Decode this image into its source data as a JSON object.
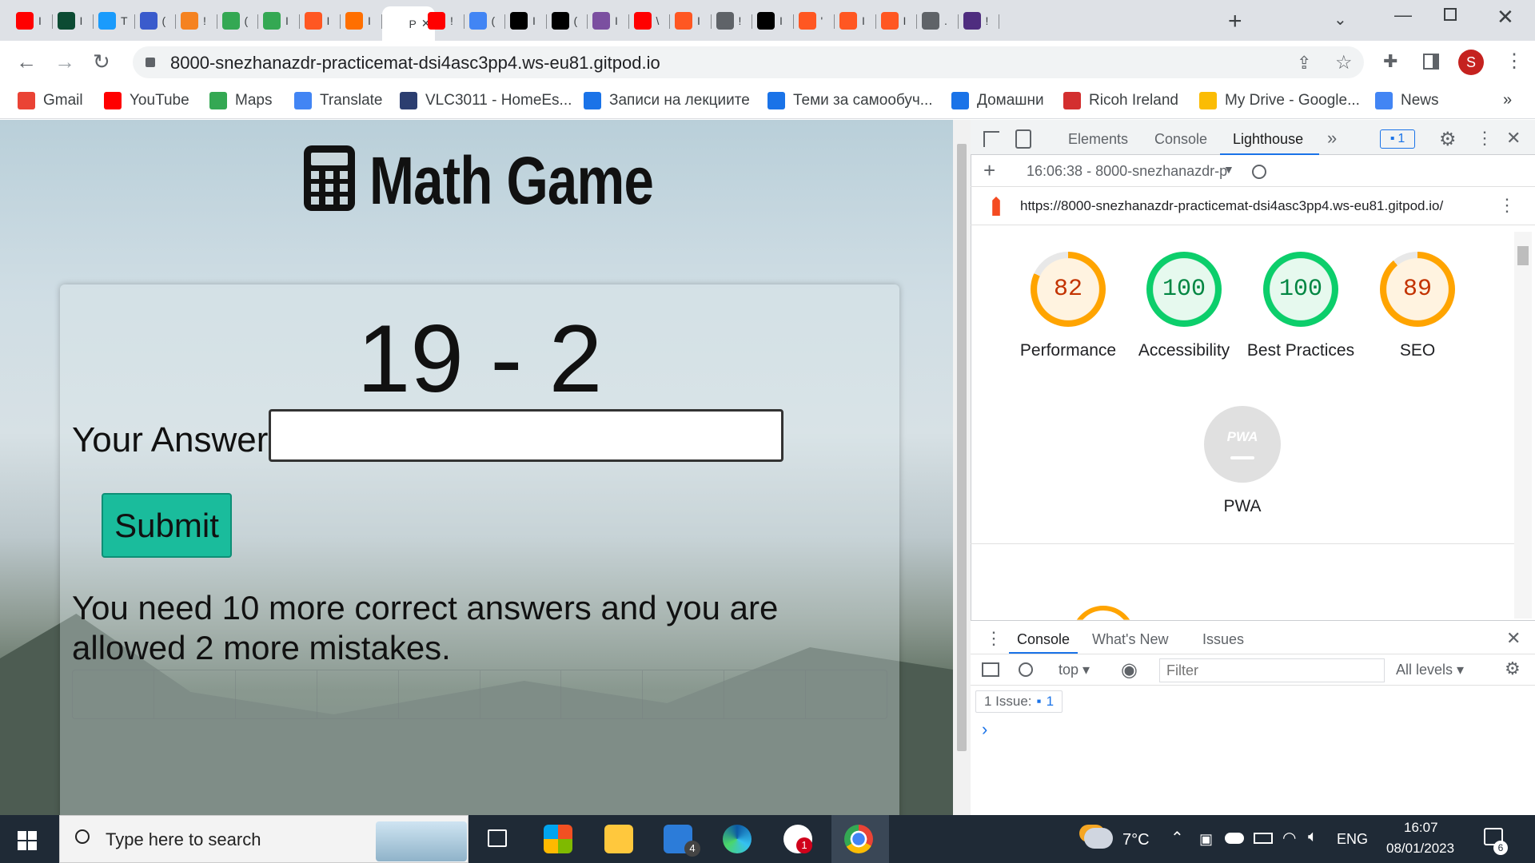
{
  "tabs": [
    {
      "label": "I",
      "color": "#ff0000",
      "icon": "youtube-icon"
    },
    {
      "label": "I",
      "color": "#0c4b33",
      "icon": "django-icon"
    },
    {
      "label": "T",
      "color": "#1a9bfc",
      "icon": "tab-icon"
    },
    {
      "label": "(",
      "color": "#3a5bcc",
      "icon": "tab-icon"
    },
    {
      "label": "!",
      "color": "#f58220",
      "icon": "tab-icon"
    },
    {
      "label": "(",
      "color": "#34a853",
      "icon": "maps-icon"
    },
    {
      "label": "I",
      "color": "#34a853",
      "icon": "maps-icon"
    },
    {
      "label": "I",
      "color": "#ff5722",
      "icon": "tab-icon"
    },
    {
      "label": "I",
      "color": "#ff6f00",
      "icon": "tab-icon"
    },
    {
      "label": "P",
      "color": "#ffffff",
      "icon": "tab-icon",
      "active": true
    },
    {
      "label": "!",
      "color": "#ff0000",
      "icon": "youtube-icon"
    },
    {
      "label": "(",
      "color": "#4285f4",
      "icon": "google-icon"
    },
    {
      "label": "I",
      "color": "#000000",
      "icon": "dev-icon"
    },
    {
      "label": "(",
      "color": "#000000",
      "icon": "medium-icon"
    },
    {
      "label": "I",
      "color": "#7b4fa0",
      "icon": "tab-icon"
    },
    {
      "label": "\\",
      "color": "#ff0000",
      "icon": "youtube-icon"
    },
    {
      "label": "I",
      "color": "#ff5722",
      "icon": "tab-icon"
    },
    {
      "label": "!",
      "color": "#5f6368",
      "icon": "globe-icon"
    },
    {
      "label": "I",
      "color": "#000000",
      "icon": "github-icon"
    },
    {
      "label": "'",
      "color": "#ff5722",
      "icon": "tab-icon"
    },
    {
      "label": "I",
      "color": "#ff5722",
      "icon": "tab-icon"
    },
    {
      "label": "I",
      "color": "#ff5722",
      "icon": "tab-icon"
    },
    {
      "label": ".",
      "color": "#5f6368",
      "icon": "globe-icon"
    },
    {
      "label": "!",
      "color": "#4f2d7f",
      "icon": "tab-icon"
    }
  ],
  "browser": {
    "url": "8000-snezhanazdr-practicemat-dsi4asc3pp4.ws-eu81.gitpod.io",
    "profile": "S"
  },
  "bookmarks": [
    {
      "label": "Gmail",
      "color": "#ea4335"
    },
    {
      "label": "YouTube",
      "color": "#ff0000"
    },
    {
      "label": "Maps",
      "color": "#34a853"
    },
    {
      "label": "Translate",
      "color": "#4285f4"
    },
    {
      "label": "VLC3011 - HomeEs...",
      "color": "#2c3e70"
    },
    {
      "label": "Записи на лекциите",
      "color": "#1a73e8"
    },
    {
      "label": "Теми за самообуч...",
      "color": "#1a73e8"
    },
    {
      "label": "Домашни",
      "color": "#1a73e8"
    },
    {
      "label": "Ricoh Ireland",
      "color": "#d32f2f"
    },
    {
      "label": "My Drive - Google...",
      "color": "#fbbc04"
    },
    {
      "label": "News",
      "color": "#4285f4"
    }
  ],
  "game": {
    "title": "Math Game",
    "question": "19 - 2",
    "answer_label": "Your Answer",
    "answer_value": "",
    "submit": "Submit",
    "message": "You need 10 more correct answers and you are allowed 2 more mistakes."
  },
  "devtools": {
    "tabs": [
      "Elements",
      "Console",
      "Lighthouse"
    ],
    "active_tab": "Lighthouse",
    "issues_badge": "1",
    "report_select": "16:06:38 - 8000-snezhanazdr-p",
    "report_url": "https://8000-snezhanazdr-practicemat-dsi4asc3pp4.ws-eu81.gitpod.io/",
    "scores": [
      {
        "value": "82",
        "label": "Performance",
        "ring": "#ffa400",
        "text": "#c33300",
        "bg": "#fff3e0",
        "fraction": 0.82
      },
      {
        "value": "100",
        "label": "Accessibility",
        "ring": "#0cce6b",
        "text": "#018642",
        "bg": "#e6f9ee",
        "fraction": 1.0
      },
      {
        "value": "100",
        "label": "Best Practices",
        "ring": "#0cce6b",
        "text": "#018642",
        "bg": "#e6f9ee",
        "fraction": 1.0
      },
      {
        "value": "89",
        "label": "SEO",
        "ring": "#ffa400",
        "text": "#c33300",
        "bg": "#fff3e0",
        "fraction": 0.89
      }
    ],
    "pwa": {
      "badge": "PWA",
      "label": "PWA"
    },
    "drawer_tabs": [
      "Console",
      "What's New",
      "Issues"
    ],
    "console_context": "top",
    "filter_placeholder": "Filter",
    "levels": "All levels",
    "issues_text": "1 Issue:",
    "issues_count": "1",
    "prompt": "›"
  },
  "taskbar": {
    "search_placeholder": "Type here to search",
    "weather": "7°C",
    "lang": "ENG",
    "time": "16:07",
    "date": "08/01/2023",
    "mail_badge": "4",
    "slack_badge": "1",
    "notif_badge": "6"
  }
}
